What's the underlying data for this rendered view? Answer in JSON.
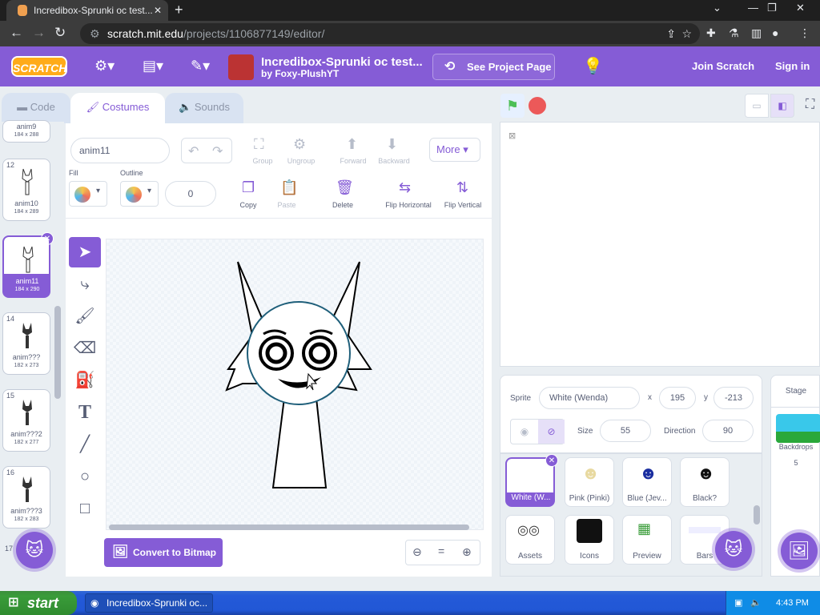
{
  "browser": {
    "tab_title": "Incredibox-Sprunki oc test...",
    "url_host": "scratch.mit.edu",
    "url_path": "/projects/1106877149/editor/"
  },
  "menu": {
    "logo": "SCRATCH",
    "project_title": "Incredibox-Sprunki oc test...",
    "author": "by Foxy-PlushYT",
    "see_project": "See Project Page",
    "join": "Join Scratch",
    "signin": "Sign in"
  },
  "tabs": {
    "code": "Code",
    "costumes": "Costumes",
    "sounds": "Sounds"
  },
  "costumes": [
    {
      "num": "",
      "name": "anim9",
      "size": "184 x 288"
    },
    {
      "num": "12",
      "name": "anim10",
      "size": "184 x 289"
    },
    {
      "num": "13",
      "name": "anim11",
      "size": "184 x 290",
      "selected": true
    },
    {
      "num": "14",
      "name": "anim???",
      "size": "182 x 273"
    },
    {
      "num": "15",
      "name": "anim???2",
      "size": "182 x 277"
    },
    {
      "num": "16",
      "name": "anim???3",
      "size": "182 x 283"
    },
    {
      "num": "17",
      "name": "",
      "size": ""
    }
  ],
  "paint": {
    "costume_name": "anim11",
    "group": "Group",
    "ungroup": "Ungroup",
    "forward": "Forward",
    "backward": "Backward",
    "more": "More",
    "fill_label": "Fill",
    "outline_label": "Outline",
    "outline_width": "0",
    "copy": "Copy",
    "paste": "Paste",
    "delete": "Delete",
    "flip_h": "Flip Horizontal",
    "flip_v": "Flip Vertical",
    "convert": "Convert to Bitmap"
  },
  "sprite_info": {
    "sprite_label": "Sprite",
    "sprite_name": "White (Wenda)",
    "x_label": "x",
    "x": "195",
    "y_label": "y",
    "y": "-213",
    "size_label": "Size",
    "size": "55",
    "direction_label": "Direction",
    "direction": "90"
  },
  "sprites": [
    {
      "name": "White (W...",
      "selected": true
    },
    {
      "name": "Pink (Pinki)"
    },
    {
      "name": "Blue (Jev..."
    },
    {
      "name": "Black?"
    },
    {
      "name": "Assets"
    },
    {
      "name": "Icons"
    },
    {
      "name": "Preview"
    },
    {
      "name": "Bars"
    }
  ],
  "stage_panel": {
    "title": "Stage",
    "backdrops_label": "Backdrops",
    "backdrops_count": "5"
  },
  "taskbar": {
    "start": "start",
    "item": "Incredibox-Sprunki oc...",
    "time": "4:43 PM"
  },
  "colors": {
    "scratch_purple": "#855cd6",
    "menu_bg": "#855cd6",
    "green_flag": "#4cbf56",
    "stop": "#ec5959"
  }
}
